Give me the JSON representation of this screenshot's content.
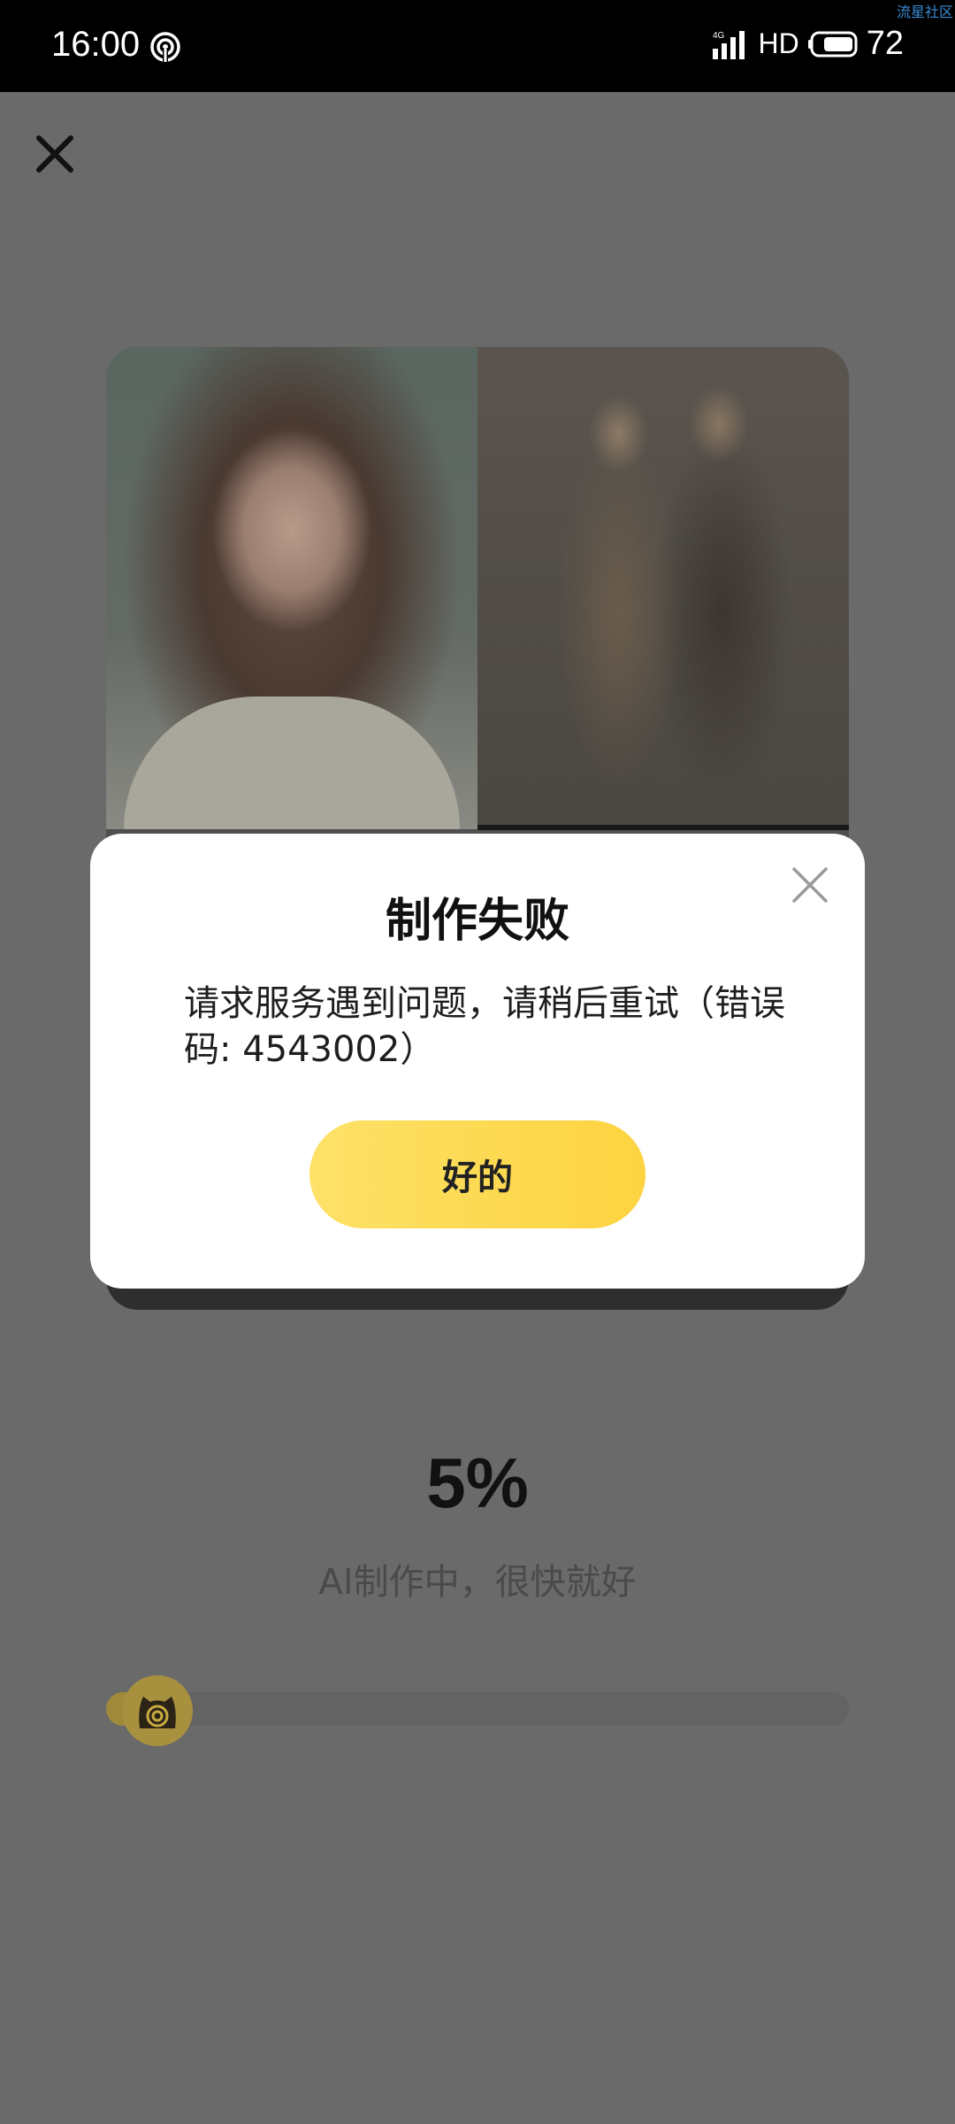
{
  "status_bar": {
    "time": "16:00",
    "network": "4G",
    "hd": "HD",
    "battery": "72",
    "watermark": "流星社区"
  },
  "icons": {
    "page_close": "close-icon",
    "dialog_close": "close-icon",
    "knob": "cat-mascot-icon"
  },
  "progress": {
    "percent_label": "5%",
    "value": 0.05,
    "status": "AI制作中，很快就好"
  },
  "dialog": {
    "title": "制作失败",
    "message": "请求服务遇到问题，请稍后重试（错误码: 4543002）",
    "ok_label": "好的"
  },
  "colors": {
    "accent": "#fdd340",
    "overlay": "#6a6a6a"
  }
}
